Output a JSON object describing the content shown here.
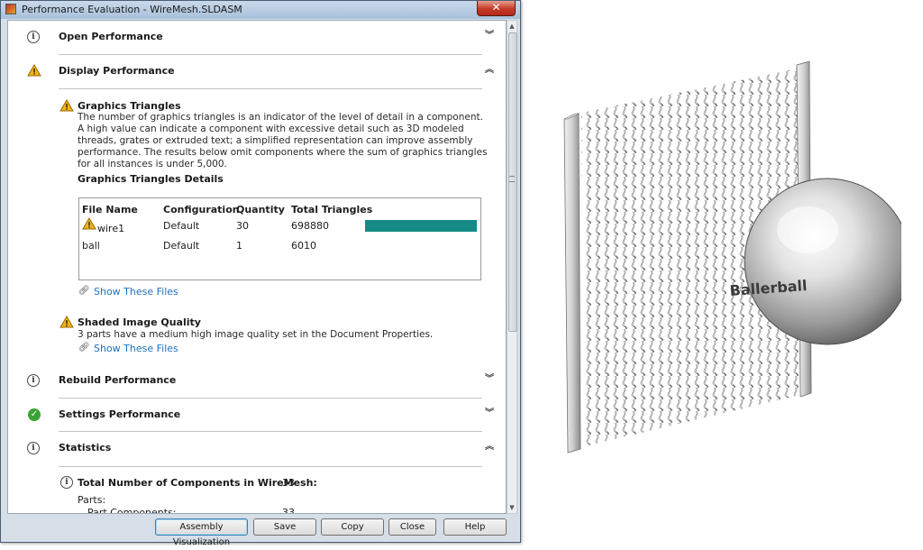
{
  "window": {
    "title": "Performance Evaluation - WireMesh.SLDASM",
    "close_label": "✕"
  },
  "sections": {
    "open": {
      "title": "Open Performance",
      "icon": "info-icon"
    },
    "display": {
      "title": "Display Performance",
      "icon": "warning-icon"
    },
    "rebuild": {
      "title": "Rebuild Performance",
      "icon": "info-icon"
    },
    "settings": {
      "title": "Settings Performance",
      "icon": "check-icon"
    },
    "statistics": {
      "title": "Statistics",
      "icon": "info-icon"
    }
  },
  "graphics": {
    "title": "Graphics Triangles",
    "description": "The number of graphics triangles is an indicator of the level of detail in a component. A high value can indicate a component with excessive detail such as 3D modeled threads, grates or extruded text; a simplified representation can improve assembly performance. The results below omit components where the sum of graphics triangles for all instances is under 5,000.",
    "details_title": "Graphics Triangles Details",
    "columns": [
      "File Name",
      "Configuration",
      "Quantity",
      "Total Triangles"
    ],
    "rows": [
      {
        "file": "wire1",
        "config": "Default",
        "qty": "30",
        "triangles": "698880",
        "fraction": 1.0
      },
      {
        "file": "ball",
        "config": "Default",
        "qty": "1",
        "triangles": "6010",
        "fraction": 0.0
      }
    ],
    "bar_color": "#158a86",
    "show_files": "Show These Files"
  },
  "shaded": {
    "title": "Shaded Image Quality",
    "description": "3 parts have a medium high image quality set in the Document Properties.",
    "show_files": "Show These Files"
  },
  "stats": {
    "total_label": "Total Number of Components in WireMesh:",
    "total_value": "33",
    "parts_label": "Parts:",
    "part_components_label": "Part Components:",
    "part_components_value": "33"
  },
  "buttons": {
    "assembly_visualization": "Assembly Visualization",
    "save": "Save",
    "copy": "Copy",
    "close": "Close",
    "help": "Help"
  },
  "model": {
    "ball_text": "Ballerball"
  }
}
